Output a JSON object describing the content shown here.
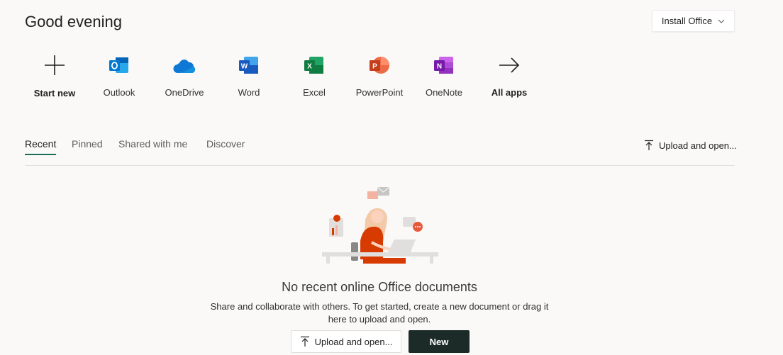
{
  "header": {
    "greeting": "Good evening",
    "install_label": "Install Office"
  },
  "apps": [
    {
      "label": "Start new",
      "icon": "plus-icon"
    },
    {
      "label": "Outlook",
      "icon": "outlook-icon",
      "color": "#0078d4"
    },
    {
      "label": "OneDrive",
      "icon": "onedrive-icon",
      "color": "#0f78d4"
    },
    {
      "label": "Word",
      "icon": "word-icon",
      "color": "#185abd"
    },
    {
      "label": "Excel",
      "icon": "excel-icon",
      "color": "#107c41"
    },
    {
      "label": "PowerPoint",
      "icon": "powerpoint-icon",
      "color": "#c43e1c"
    },
    {
      "label": "OneNote",
      "icon": "onenote-icon",
      "color": "#7719aa"
    },
    {
      "label": "All apps",
      "icon": "arrow-right-icon"
    }
  ],
  "tabs": [
    {
      "label": "Recent",
      "active": true
    },
    {
      "label": "Pinned",
      "active": false
    },
    {
      "label": "Shared with me",
      "active": false
    },
    {
      "label": "Discover",
      "active": false
    }
  ],
  "upload_top_label": "Upload and open...",
  "empty_state": {
    "title": "No recent online Office documents",
    "description": "Share and collaborate with others. To get started, create a new document or drag it here to upload and open.",
    "upload_label": "Upload and open...",
    "new_label": "New"
  },
  "accent_color": "#1b6e5a"
}
